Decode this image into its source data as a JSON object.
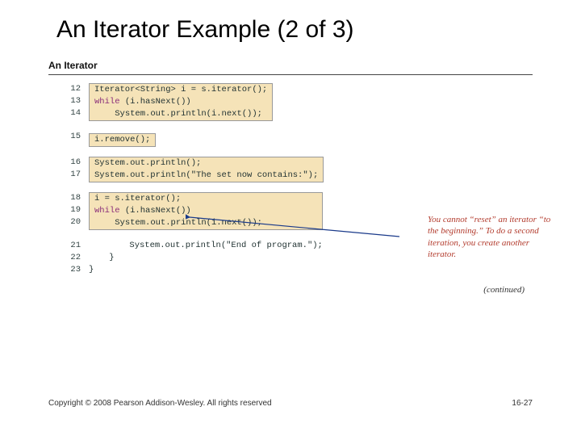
{
  "title": "An Iterator Example (2 of 3)",
  "subheading": "An Iterator",
  "blocks": {
    "b1": {
      "lines": [
        "12",
        "13",
        "14"
      ],
      "code": [
        {
          "pre": "",
          "kw": "",
          "body": "Iterator<String> i = s.iterator();"
        },
        {
          "pre": "",
          "kw": "while",
          "body": " (i.hasNext())"
        },
        {
          "pre": "    ",
          "kw": "",
          "body": "System.out.println(i.next());"
        }
      ]
    },
    "b2": {
      "lines": [
        "15"
      ],
      "code": [
        {
          "pre": "",
          "kw": "",
          "body": "i.remove();"
        }
      ]
    },
    "b3": {
      "lines": [
        "16",
        "17"
      ],
      "code": [
        {
          "pre": "",
          "kw": "",
          "body": "System.out.println();"
        },
        {
          "pre": "",
          "kw": "",
          "body": "System.out.println(\"The set now contains:\");"
        }
      ]
    },
    "b4": {
      "lines": [
        "18",
        "19",
        "20"
      ],
      "code": [
        {
          "pre": "",
          "kw": "",
          "body": "i = s.iterator();"
        },
        {
          "pre": "",
          "kw": "while",
          "body": " (i.hasNext())"
        },
        {
          "pre": "    ",
          "kw": "",
          "body": "System.out.println(i.next());"
        }
      ]
    },
    "b5": {
      "lines": [
        "21",
        "22",
        "23"
      ],
      "plain": [
        "        System.out.println(\"End of program.\");",
        "    }",
        "}"
      ]
    }
  },
  "annotation": "You cannot “reset” an iterator “to the beginning.” To do a second iteration, you create another iterator.",
  "continued": "(continued)",
  "footer_left": "Copyright © 2008 Pearson Addison-Wesley. All rights reserved",
  "footer_right": "16-27"
}
